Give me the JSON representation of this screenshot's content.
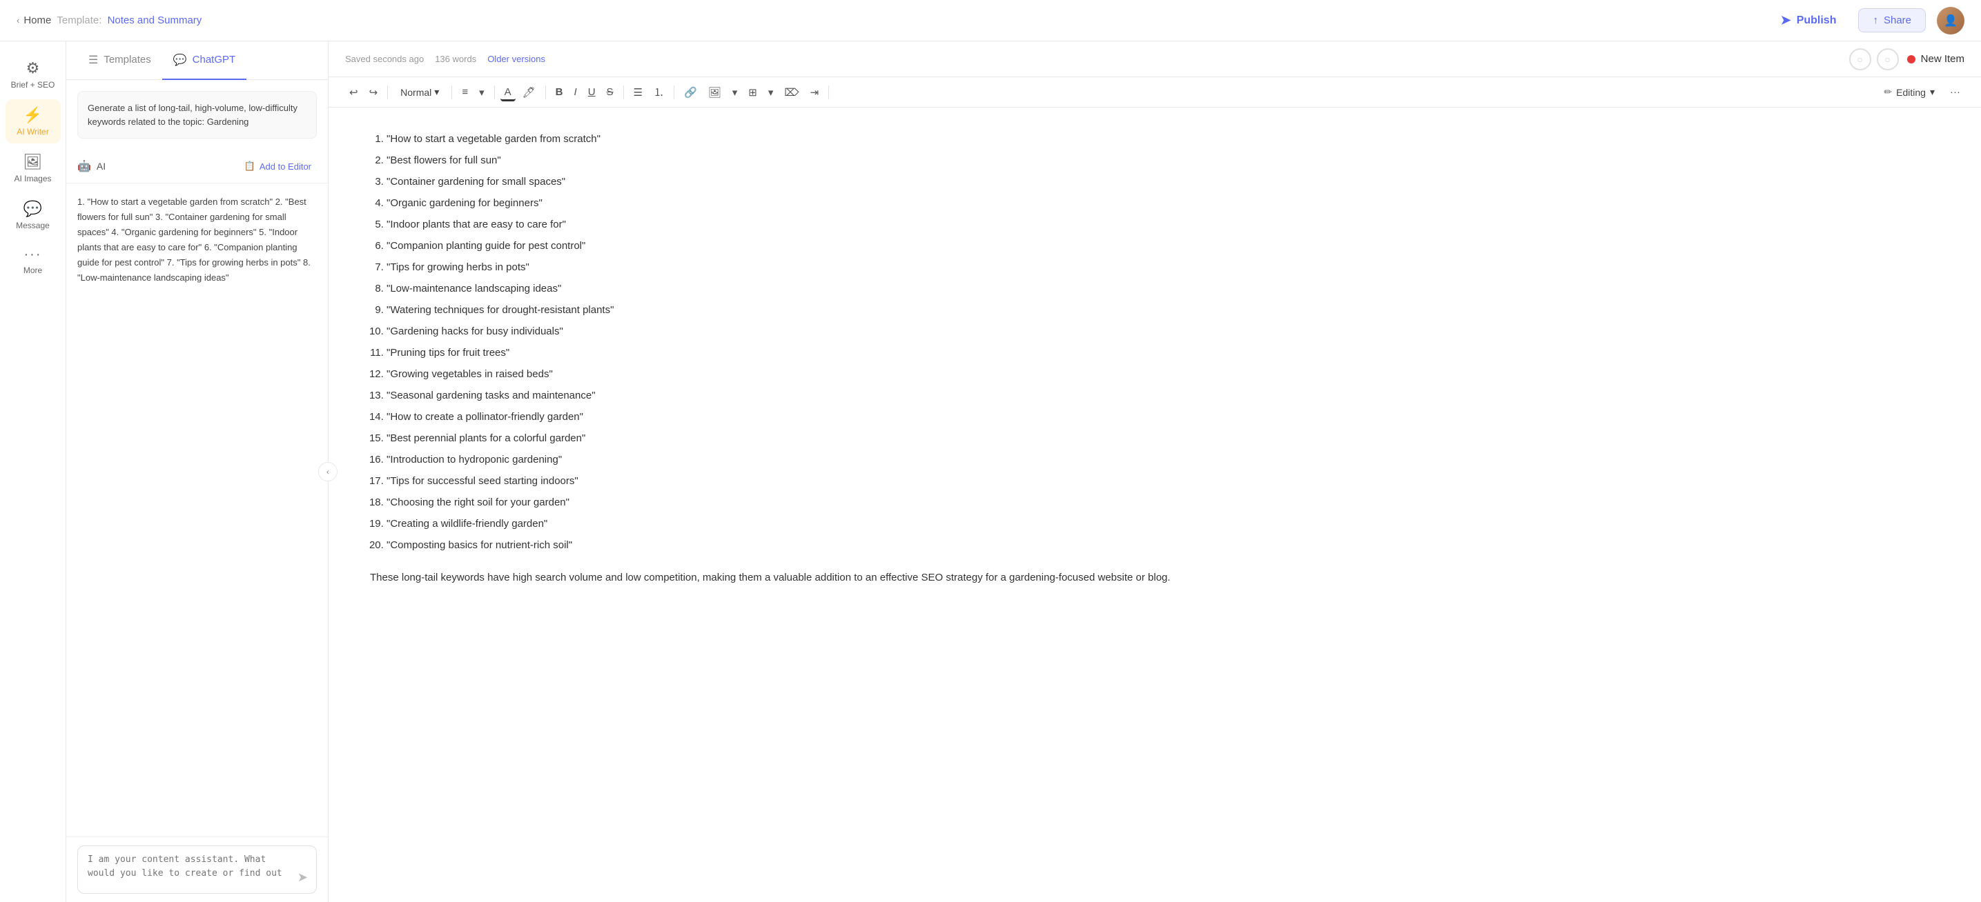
{
  "topbar": {
    "home_label": "Home",
    "template_prefix": "Template:",
    "template_name": "Notes and Summary",
    "publish_label": "Publish",
    "share_label": "Share"
  },
  "sidebar": {
    "items": [
      {
        "id": "brief-seo",
        "icon": "⚙",
        "label": "Brief + SEO",
        "active": false
      },
      {
        "id": "ai-writer",
        "icon": "⚡",
        "label": "AI Writer",
        "active": true
      },
      {
        "id": "ai-images",
        "icon": "🖼",
        "label": "AI Images",
        "active": false
      },
      {
        "id": "message",
        "icon": "💬",
        "label": "Message",
        "active": false
      }
    ],
    "more_label": "More"
  },
  "panel": {
    "tabs": [
      {
        "id": "templates",
        "icon": "☰",
        "label": "Templates",
        "active": false
      },
      {
        "id": "chatgpt",
        "icon": "💬",
        "label": "ChatGPT",
        "active": true
      }
    ],
    "template_tooltip": "Generate a list of long-tail, high-volume, low-difficulty keywords related to the topic: Gardening",
    "ai_label": "AI",
    "add_to_editor_label": "Add to Editor",
    "ai_content": "1. \"How to start a vegetable garden from scratch\"\n2. \"Best flowers for full sun\"\n3. \"Container gardening for small spaces\"\n4. \"Organic gardening for beginners\"\n5. \"Indoor plants that are easy to care for\"\n6. \"Companion planting guide for pest control\"\n7. \"Tips for growing herbs in pots\"\n8. \"Low-maintenance landscaping ideas\"",
    "chat_placeholder": "I am your content assistant. What would you like to create or find out today?"
  },
  "editor": {
    "saved_label": "Saved seconds ago",
    "word_count": "136 words",
    "older_versions_label": "Older versions",
    "new_item_label": "New Item",
    "editing_label": "Editing",
    "format_style": "Normal",
    "content_items": [
      "\"How to start a vegetable garden from scratch\"",
      "\"Best flowers for full sun\"",
      "\"Container gardening for small spaces\"",
      "\"Organic gardening for beginners\"",
      "\"Indoor plants that are easy to care for\"",
      "\"Companion planting guide for pest control\"",
      "\"Tips for growing herbs in pots\"",
      "\"Low-maintenance landscaping ideas\"",
      "\"Watering techniques for drought-resistant plants\"",
      "\"Gardening hacks for busy individuals\"",
      "\"Pruning tips for fruit trees\"",
      "\"Growing vegetables in raised beds\"",
      "\"Seasonal gardening tasks and maintenance\"",
      "\"How to create a pollinator-friendly garden\"",
      "\"Best perennial plants for a colorful garden\"",
      "\"Introduction to hydroponic gardening\"",
      "\"Tips for successful seed starting indoors\"",
      "\"Choosing the right soil for your garden\"",
      "\"Creating a wildlife-friendly garden\"",
      "\"Composting basics for nutrient-rich soil\""
    ],
    "footer_text": "These long-tail keywords have high search volume and low competition, making them a valuable addition to an effective SEO strategy for a gardening-focused website or blog."
  }
}
